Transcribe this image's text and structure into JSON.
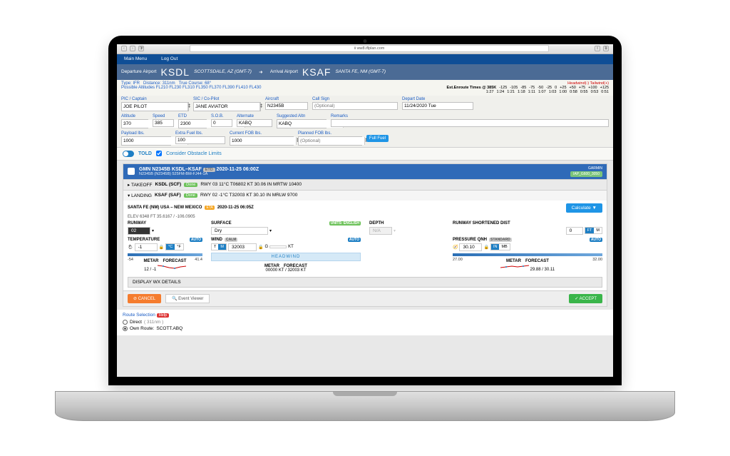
{
  "browser": {
    "url": "ii ww8.iflplan.com"
  },
  "menubar": {
    "mainmenu": "Main Menu",
    "logout": "Log Out"
  },
  "route": {
    "dep_lbl": "Departure Airport",
    "dep_code": "KSDL",
    "dep_loc": "SCOTTSDALE, AZ (GMT-7)",
    "arr_lbl": "Arrival Airport",
    "arr_code": "KSAF",
    "arr_loc": "SANTA FE, NM (GMT-7)"
  },
  "infobar": {
    "type": "Type: IFR",
    "distance": "Distance: 311nm",
    "course": "True Course: 68°",
    "alts": "Possible Altitudes FL210 FL230 FL310 FL350 FL370 FL390 FL410 FL430",
    "headwind": "Headwind(-) Tailwind(+)",
    "enroute": "Est.Enroute Times @ 385K",
    "cols": [
      "-125",
      "-105",
      "-85",
      "-75",
      "-50",
      "-25",
      "0",
      "+25",
      "+50",
      "+75",
      "+100",
      "+125"
    ],
    "vals": [
      "1:27",
      "1:24",
      "1:21",
      "1:18",
      "1:11",
      "1:07",
      "1:03",
      "1:00",
      "0:58",
      "0:55",
      "0:53",
      "0:51"
    ]
  },
  "form1": {
    "pic": {
      "label": "PIC / Captain",
      "value": "JOE PILOT"
    },
    "sic": {
      "label": "SIC / Co-Pilot",
      "value": "JANE AVIATOR"
    },
    "aircraft": {
      "label": "Aircraft",
      "value": "N2345B"
    },
    "callsign": {
      "label": "Call Sign",
      "placeholder": "(Optional)"
    },
    "depdate": {
      "label": "Depart Date",
      "value": "11/24/2020 Tue"
    }
  },
  "form2": {
    "altitude": {
      "label": "Altitude",
      "value": "370"
    },
    "speed": {
      "label": "Speed",
      "value": "385"
    },
    "etd": {
      "label": "ETD",
      "value": "2300"
    },
    "sob": {
      "label": "S.O.B.",
      "value": "0"
    },
    "alternate": {
      "label": "Alternate",
      "value": "KABQ"
    },
    "sugalt": {
      "label": "Suggested Altn",
      "value": "KABQ"
    },
    "remarks": {
      "label": "Remarks",
      "value": ""
    },
    "payload": {
      "label": "Payload lbs.",
      "value": "1000"
    },
    "extrafuel": {
      "label": "Extra Fuel lbs.",
      "value": "100"
    },
    "curfob": {
      "label": "Current FOB lbs.",
      "value": "1000"
    },
    "planfob": {
      "label": "Planned FOB lbs.",
      "placeholder": "(Optional)"
    },
    "fullfuel": "Full Fuel"
  },
  "told": {
    "title": "TOLD",
    "obstacle": "Consider Obstacle Limits",
    "hdr_t1": "GMN N2345B KSDL–KSAF",
    "hdr_etd": "ETD",
    "hdr_time": "2020-11-25 06:00Z",
    "hdr_sub": "N2345B (N2345B)  525FM-BM-FJ44-1A",
    "garmin": "GARMIN",
    "garmin_sub": "IAP_G600_3050",
    "takeoff": {
      "l": "▸ TAKEOFF",
      "ap": "KSDL (SCF)",
      "done": "Done",
      "wx": "RWY 03  11°C  T06802 KT  30.06 IN  MRTW 10400"
    },
    "landing": {
      "l": "▾ LANDING",
      "ap": "KSAF (SAF)",
      "done": "Done",
      "wx": "RWY 02  -1°C  T32003 KT  30.10 IN  MRLW 9700"
    },
    "body": {
      "title": "SANTA FE (NM) USA – NEW MEXICO",
      "eta": "ETA",
      "eta_t": "2020-11-25 06:05Z",
      "elev": "ELEV 6348 FT   35.6167 / -106.0905",
      "calc": "Calculate ▼",
      "runway": {
        "label": "RUNWAY",
        "val": "02"
      },
      "surface": {
        "label": "SURFACE",
        "units": "UNITS: ENGLISH",
        "val": "Dry"
      },
      "depth": {
        "label": "DEPTH",
        "val": "N/A"
      },
      "shortened": {
        "label": "RUNWAY SHORTENED DIST",
        "val": "0",
        "u1": "FT",
        "u2": "M"
      },
      "temp": {
        "label": "TEMPERATURE",
        "auto": "AUTO",
        "val": "-1",
        "u1": "°C",
        "u2": "°F",
        "lo": "-54",
        "hi": "41.4",
        "mf_m": "METAR",
        "mf_f": "FORECAST",
        "mf_val": "12 / -1"
      },
      "wind": {
        "label": "WIND",
        "calm": "CALM",
        "auto": "AUTO",
        "t": "T",
        "m": "M",
        "val": "32003",
        "g": "G",
        "kt": "KT",
        "head": "HEADWIND",
        "mf_m": "METAR",
        "mf_f": "FORECAST",
        "mf_val": "00000 KT / 32003 KT"
      },
      "qnh": {
        "label": "PRESSURE QNH",
        "std": "STANDARD",
        "auto": "AUTO",
        "val": "30.10",
        "u1": "IN",
        "u2": "MB",
        "lo": "27.00",
        "hi": "32.00",
        "mf_m": "METAR",
        "mf_f": "FORECAST",
        "mf_val": "29.88 / 30.11"
      },
      "wx": "DISPLAY WX DETAILS"
    },
    "foot": {
      "cancel": "⊘ CANCEL",
      "event": "🔍 Event Viewer",
      "accept": "✓ ACCEPT"
    }
  },
  "routesel": {
    "title": "Route Selection",
    "help": "Help",
    "direct": "Direct",
    "direct_note": "( 311nm )",
    "own": "Own Route:",
    "own_val": "SCOTT.ABQ"
  }
}
